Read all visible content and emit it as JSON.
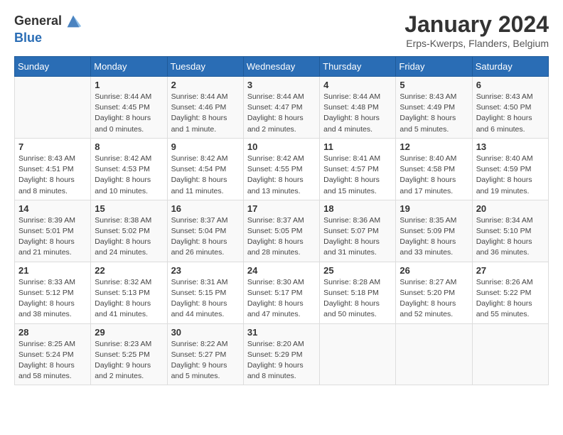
{
  "header": {
    "logo_line1": "General",
    "logo_line2": "Blue",
    "month": "January 2024",
    "location": "Erps-Kwerps, Flanders, Belgium"
  },
  "weekdays": [
    "Sunday",
    "Monday",
    "Tuesday",
    "Wednesday",
    "Thursday",
    "Friday",
    "Saturday"
  ],
  "weeks": [
    [
      {
        "day": "",
        "sunrise": "",
        "sunset": "",
        "daylight": ""
      },
      {
        "day": "1",
        "sunrise": "Sunrise: 8:44 AM",
        "sunset": "Sunset: 4:45 PM",
        "daylight": "Daylight: 8 hours and 0 minutes."
      },
      {
        "day": "2",
        "sunrise": "Sunrise: 8:44 AM",
        "sunset": "Sunset: 4:46 PM",
        "daylight": "Daylight: 8 hours and 1 minute."
      },
      {
        "day": "3",
        "sunrise": "Sunrise: 8:44 AM",
        "sunset": "Sunset: 4:47 PM",
        "daylight": "Daylight: 8 hours and 2 minutes."
      },
      {
        "day": "4",
        "sunrise": "Sunrise: 8:44 AM",
        "sunset": "Sunset: 4:48 PM",
        "daylight": "Daylight: 8 hours and 4 minutes."
      },
      {
        "day": "5",
        "sunrise": "Sunrise: 8:43 AM",
        "sunset": "Sunset: 4:49 PM",
        "daylight": "Daylight: 8 hours and 5 minutes."
      },
      {
        "day": "6",
        "sunrise": "Sunrise: 8:43 AM",
        "sunset": "Sunset: 4:50 PM",
        "daylight": "Daylight: 8 hours and 6 minutes."
      }
    ],
    [
      {
        "day": "7",
        "sunrise": "Sunrise: 8:43 AM",
        "sunset": "Sunset: 4:51 PM",
        "daylight": "Daylight: 8 hours and 8 minutes."
      },
      {
        "day": "8",
        "sunrise": "Sunrise: 8:42 AM",
        "sunset": "Sunset: 4:53 PM",
        "daylight": "Daylight: 8 hours and 10 minutes."
      },
      {
        "day": "9",
        "sunrise": "Sunrise: 8:42 AM",
        "sunset": "Sunset: 4:54 PM",
        "daylight": "Daylight: 8 hours and 11 minutes."
      },
      {
        "day": "10",
        "sunrise": "Sunrise: 8:42 AM",
        "sunset": "Sunset: 4:55 PM",
        "daylight": "Daylight: 8 hours and 13 minutes."
      },
      {
        "day": "11",
        "sunrise": "Sunrise: 8:41 AM",
        "sunset": "Sunset: 4:57 PM",
        "daylight": "Daylight: 8 hours and 15 minutes."
      },
      {
        "day": "12",
        "sunrise": "Sunrise: 8:40 AM",
        "sunset": "Sunset: 4:58 PM",
        "daylight": "Daylight: 8 hours and 17 minutes."
      },
      {
        "day": "13",
        "sunrise": "Sunrise: 8:40 AM",
        "sunset": "Sunset: 4:59 PM",
        "daylight": "Daylight: 8 hours and 19 minutes."
      }
    ],
    [
      {
        "day": "14",
        "sunrise": "Sunrise: 8:39 AM",
        "sunset": "Sunset: 5:01 PM",
        "daylight": "Daylight: 8 hours and 21 minutes."
      },
      {
        "day": "15",
        "sunrise": "Sunrise: 8:38 AM",
        "sunset": "Sunset: 5:02 PM",
        "daylight": "Daylight: 8 hours and 24 minutes."
      },
      {
        "day": "16",
        "sunrise": "Sunrise: 8:37 AM",
        "sunset": "Sunset: 5:04 PM",
        "daylight": "Daylight: 8 hours and 26 minutes."
      },
      {
        "day": "17",
        "sunrise": "Sunrise: 8:37 AM",
        "sunset": "Sunset: 5:05 PM",
        "daylight": "Daylight: 8 hours and 28 minutes."
      },
      {
        "day": "18",
        "sunrise": "Sunrise: 8:36 AM",
        "sunset": "Sunset: 5:07 PM",
        "daylight": "Daylight: 8 hours and 31 minutes."
      },
      {
        "day": "19",
        "sunrise": "Sunrise: 8:35 AM",
        "sunset": "Sunset: 5:09 PM",
        "daylight": "Daylight: 8 hours and 33 minutes."
      },
      {
        "day": "20",
        "sunrise": "Sunrise: 8:34 AM",
        "sunset": "Sunset: 5:10 PM",
        "daylight": "Daylight: 8 hours and 36 minutes."
      }
    ],
    [
      {
        "day": "21",
        "sunrise": "Sunrise: 8:33 AM",
        "sunset": "Sunset: 5:12 PM",
        "daylight": "Daylight: 8 hours and 38 minutes."
      },
      {
        "day": "22",
        "sunrise": "Sunrise: 8:32 AM",
        "sunset": "Sunset: 5:13 PM",
        "daylight": "Daylight: 8 hours and 41 minutes."
      },
      {
        "day": "23",
        "sunrise": "Sunrise: 8:31 AM",
        "sunset": "Sunset: 5:15 PM",
        "daylight": "Daylight: 8 hours and 44 minutes."
      },
      {
        "day": "24",
        "sunrise": "Sunrise: 8:30 AM",
        "sunset": "Sunset: 5:17 PM",
        "daylight": "Daylight: 8 hours and 47 minutes."
      },
      {
        "day": "25",
        "sunrise": "Sunrise: 8:28 AM",
        "sunset": "Sunset: 5:18 PM",
        "daylight": "Daylight: 8 hours and 50 minutes."
      },
      {
        "day": "26",
        "sunrise": "Sunrise: 8:27 AM",
        "sunset": "Sunset: 5:20 PM",
        "daylight": "Daylight: 8 hours and 52 minutes."
      },
      {
        "day": "27",
        "sunrise": "Sunrise: 8:26 AM",
        "sunset": "Sunset: 5:22 PM",
        "daylight": "Daylight: 8 hours and 55 minutes."
      }
    ],
    [
      {
        "day": "28",
        "sunrise": "Sunrise: 8:25 AM",
        "sunset": "Sunset: 5:24 PM",
        "daylight": "Daylight: 8 hours and 58 minutes."
      },
      {
        "day": "29",
        "sunrise": "Sunrise: 8:23 AM",
        "sunset": "Sunset: 5:25 PM",
        "daylight": "Daylight: 9 hours and 2 minutes."
      },
      {
        "day": "30",
        "sunrise": "Sunrise: 8:22 AM",
        "sunset": "Sunset: 5:27 PM",
        "daylight": "Daylight: 9 hours and 5 minutes."
      },
      {
        "day": "31",
        "sunrise": "Sunrise: 8:20 AM",
        "sunset": "Sunset: 5:29 PM",
        "daylight": "Daylight: 9 hours and 8 minutes."
      },
      {
        "day": "",
        "sunrise": "",
        "sunset": "",
        "daylight": ""
      },
      {
        "day": "",
        "sunrise": "",
        "sunset": "",
        "daylight": ""
      },
      {
        "day": "",
        "sunrise": "",
        "sunset": "",
        "daylight": ""
      }
    ]
  ]
}
